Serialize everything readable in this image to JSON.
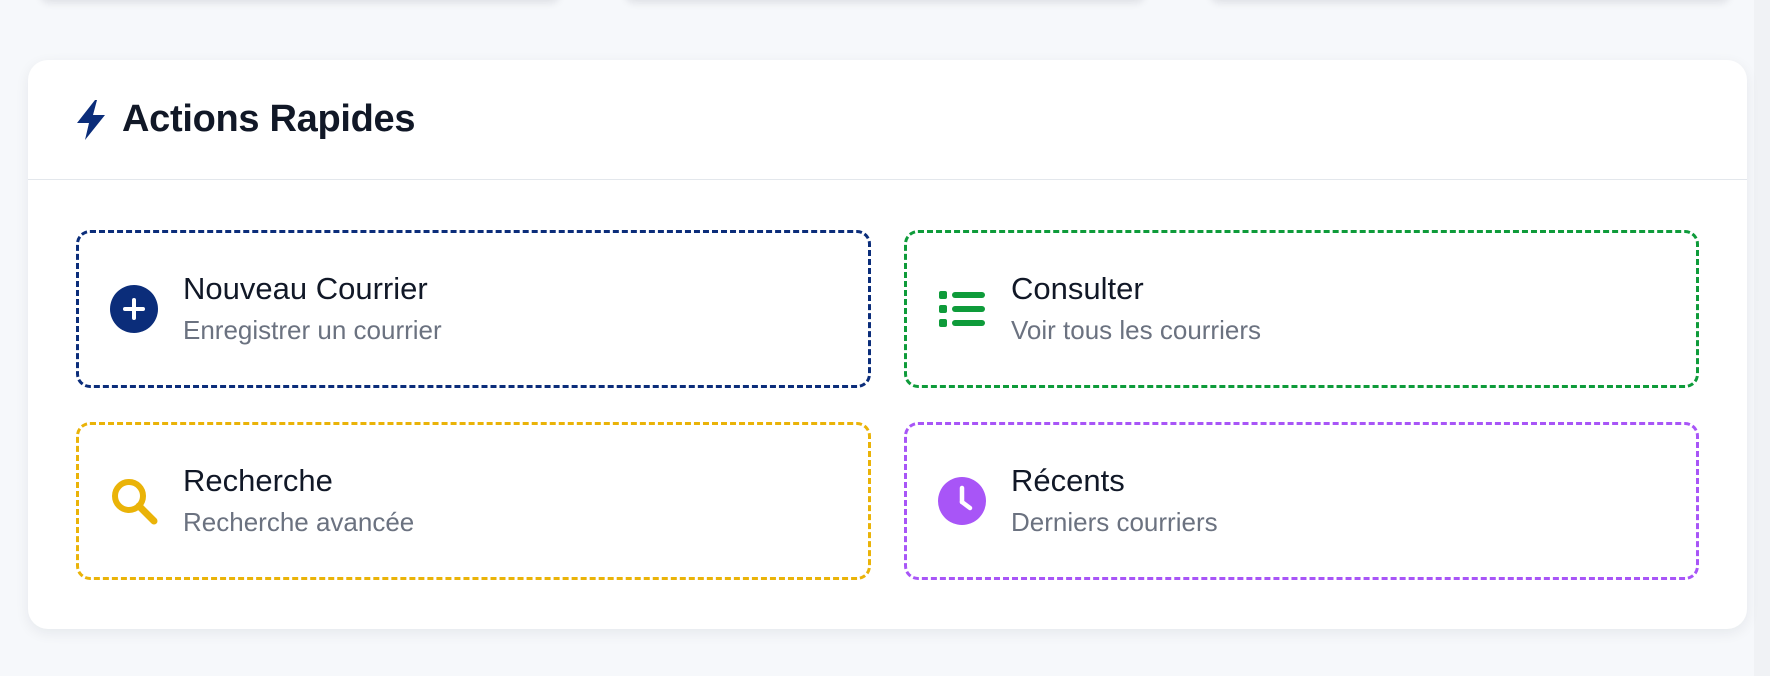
{
  "colors": {
    "blue": "#0b2d7a",
    "green": "#0e9b3a",
    "yellow": "#eab308",
    "purple": "#a855f7",
    "title_text": "#111827",
    "subtitle_text": "#6b7280"
  },
  "panel": {
    "icon": "bolt-icon",
    "title": "Actions Rapides"
  },
  "actions": [
    {
      "icon": "plus-circle-icon",
      "title": "Nouveau Courrier",
      "subtitle": "Enregistrer un courrier",
      "color": "#0b2d7a"
    },
    {
      "icon": "list-icon",
      "title": "Consulter",
      "subtitle": "Voir tous les courriers",
      "color": "#0e9b3a"
    },
    {
      "icon": "search-icon",
      "title": "Recherche",
      "subtitle": "Recherche avancée",
      "color": "#eab308"
    },
    {
      "icon": "clock-icon",
      "title": "Récents",
      "subtitle": "Derniers courriers",
      "color": "#a855f7"
    }
  ]
}
